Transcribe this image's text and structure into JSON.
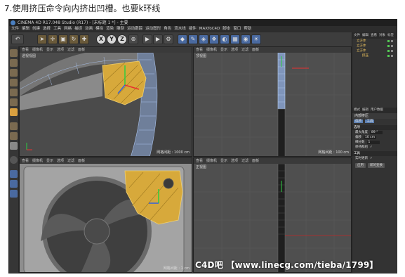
{
  "caption": "7.使用挤压命令向内挤出凹槽。也要k环线",
  "window": {
    "title": "CINEMA 4D R17.048 Studio (R17) - [未标题 1 *] - 主要"
  },
  "menubar": [
    "文件",
    "编辑",
    "创建",
    "选择",
    "工具",
    "网格",
    "捕捉",
    "动画",
    "模拟",
    "渲染",
    "雕刻",
    "运动跟踪",
    "运动图形",
    "角色",
    "流水线",
    "插件",
    "MAXToC4D",
    "脚本",
    "窗口",
    "帮助"
  ],
  "toolbar": {
    "undo_icon": "undo-icon",
    "axis_x": "X",
    "axis_y": "Y",
    "axis_z": "Z"
  },
  "viewport_menu": [
    "查看",
    "摄像机",
    "显示",
    "选项",
    "过滤",
    "面板"
  ],
  "viewports": {
    "persp": {
      "label": "透视视图",
      "grid": "网格间距 : 1000 cm"
    },
    "top": {
      "label": "顶视图",
      "grid": "网格间距 : 100 cm"
    },
    "right": {
      "label": "",
      "grid": "网格间距 : 1 cm"
    },
    "front": {
      "label": "正视图",
      "grid": ""
    }
  },
  "right_panel": {
    "tabs": [
      "文件",
      "编辑",
      "查看",
      "对象",
      "标签"
    ],
    "objects": [
      "立方体",
      "立方体",
      "立方体",
      "挤压"
    ],
    "attr_tabs": [
      "模式",
      "编辑",
      "用户数据"
    ],
    "attr_title": "内部挤压",
    "attr_sub_tabs": [
      "选项",
      "工具"
    ],
    "section_options": "选项",
    "rows": [
      {
        "label": "最大角度",
        "value": "89 °"
      },
      {
        "label": "偏移",
        "value": "10 cm"
      },
      {
        "label": "细分数",
        "value": "1"
      },
      {
        "label": "保持群组",
        "value": "✓"
      }
    ],
    "section_tool": "工具",
    "realtime_label": "实时更新",
    "realtime_value": "✓",
    "apply_button": "应用",
    "new_transform_button": "新的变换"
  },
  "watermark": "C4D吧  【www.linecg.com/tieba/1799】"
}
